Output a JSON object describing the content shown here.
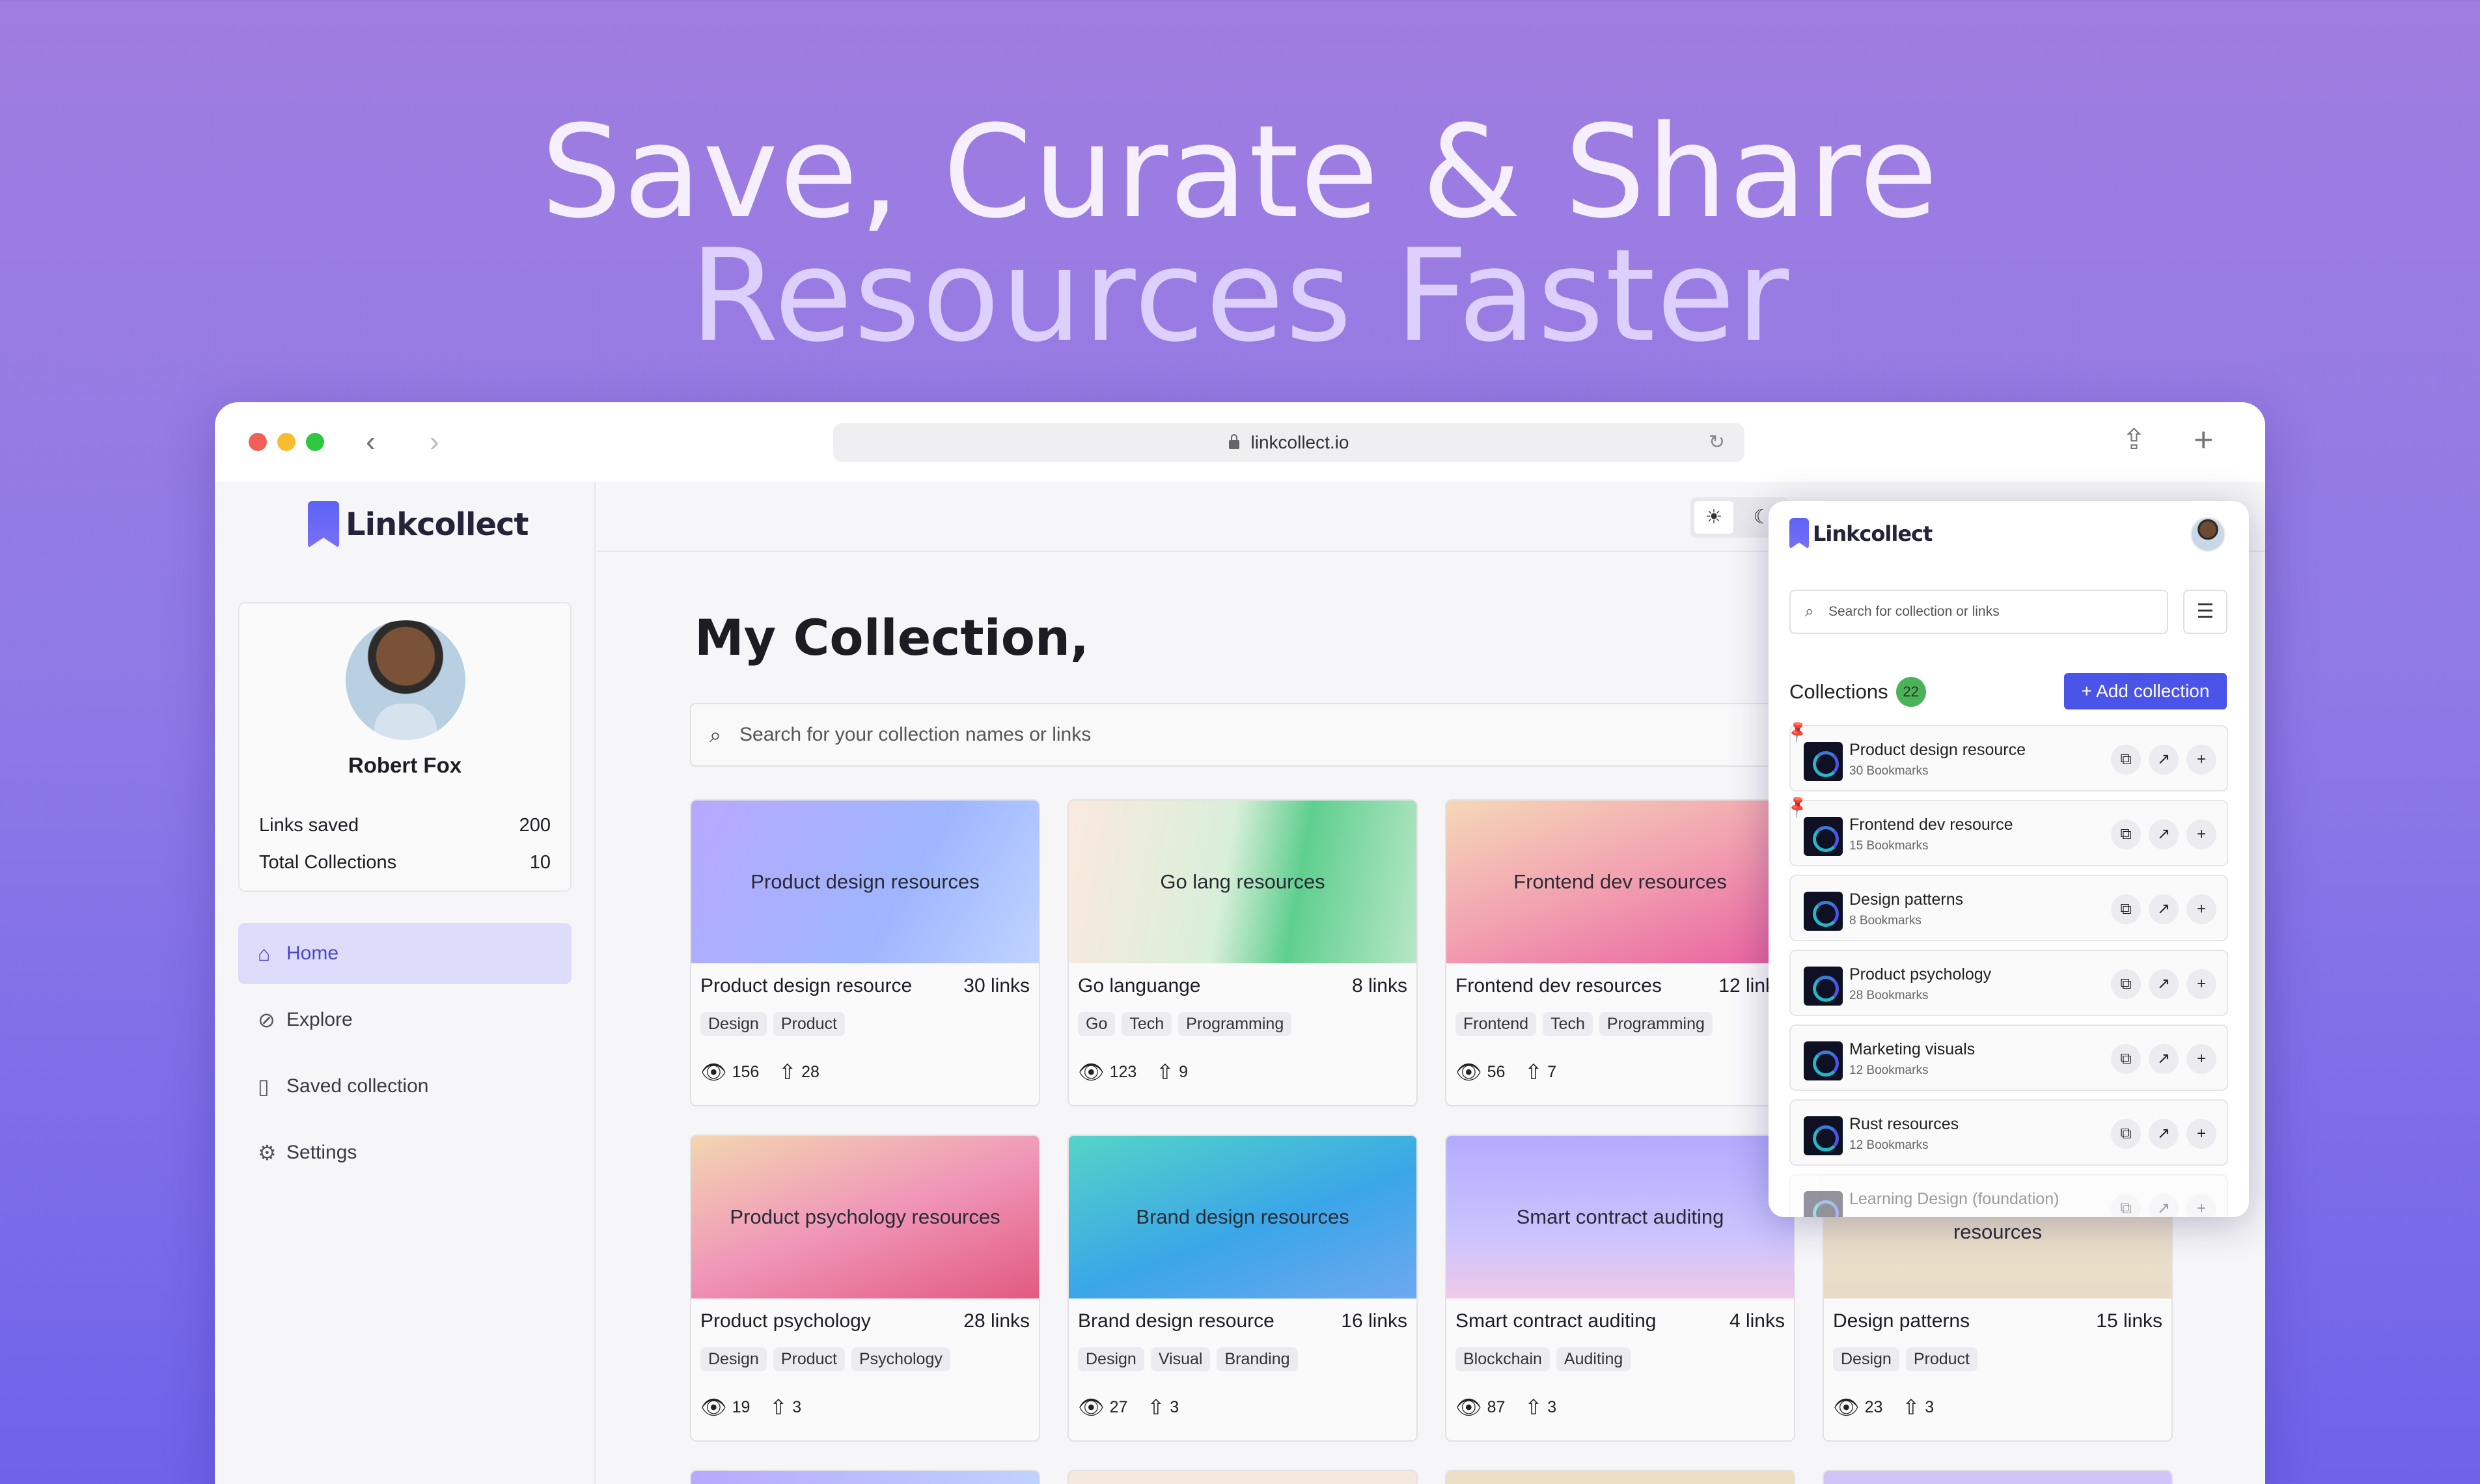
{
  "hero": {
    "line1": "Save, Curate & Share",
    "line2": "Resources Faster"
  },
  "browser": {
    "url": "linkcollect.io",
    "back_icon": "chevron-left-icon",
    "forward_icon": "chevron-right-icon",
    "share_icon": "share-icon",
    "newtab_icon": "plus-icon",
    "traffic_colors": [
      "#f25f57",
      "#f7bd2e",
      "#2bc840"
    ]
  },
  "sidebar": {
    "logo": "Linkcollect",
    "profile": {
      "name": "Robert Fox",
      "links_saved_label": "Links saved",
      "links_saved": "200",
      "total_collections_label": "Total Collections",
      "total_collections": "10"
    },
    "menu": [
      {
        "label": "Home",
        "icon": "home-icon"
      },
      {
        "label": "Explore",
        "icon": "compass-icon"
      },
      {
        "label": "Saved collection",
        "icon": "bookmark-icon"
      },
      {
        "label": "Settings",
        "icon": "gear-icon"
      }
    ]
  },
  "main": {
    "title": "My Collection,",
    "search_placeholder": "Search for your collection names or links",
    "cards": [
      {
        "thumb": "Product design resources",
        "name": "Product design resource",
        "links": "30 links",
        "tags": [
          "Design",
          "Product"
        ],
        "views": "156",
        "votes": "28"
      },
      {
        "thumb": "Go lang resources",
        "name": "Go languange",
        "links": "8 links",
        "tags": [
          "Go",
          "Tech",
          "Programming"
        ],
        "views": "123",
        "votes": "9"
      },
      {
        "thumb": "Frontend dev resources",
        "name": "Frontend dev resources",
        "links": "12 links",
        "tags": [
          "Frontend",
          "Tech",
          "Programming"
        ],
        "views": "56",
        "votes": "7"
      },
      {
        "thumb": "Product psychology resources",
        "name": "Product psychology",
        "links": "28 links",
        "tags": [
          "Design",
          "Product",
          "Psychology"
        ],
        "views": "19",
        "votes": "3"
      },
      {
        "thumb": "Brand design resources",
        "name": "Brand design resource",
        "links": "16 links",
        "tags": [
          "Design",
          "Visual",
          "Branding"
        ],
        "views": "27",
        "votes": "3"
      },
      {
        "thumb": "Smart contract auditing",
        "name": "Smart contract auditing",
        "links": "4 links",
        "tags": [
          "Blockchain",
          "Auditing"
        ],
        "views": "87",
        "votes": "3"
      },
      {
        "thumb": "resources",
        "name": "Design patterns",
        "links": "15 links",
        "tags": [
          "Design",
          "Product"
        ],
        "views": "23",
        "votes": "3"
      }
    ]
  },
  "popup": {
    "logo": "Linkcollect",
    "search_placeholder": "Search for collection or links",
    "collections_label": "Collections",
    "collections_count": "22",
    "add_label": "+ Add collection",
    "items": [
      {
        "title": "Product design resource",
        "sub": "30 Bookmarks",
        "pinned": true
      },
      {
        "title": "Frontend dev resource",
        "sub": "15 Bookmarks",
        "pinned": true
      },
      {
        "title": "Design patterns",
        "sub": "8 Bookmarks",
        "pinned": false
      },
      {
        "title": "Product psychology",
        "sub": "28 Bookmarks",
        "pinned": false
      },
      {
        "title": "Marketing visuals",
        "sub": "12 Bookmarks",
        "pinned": false
      },
      {
        "title": "Rust resources",
        "sub": "12 Bookmarks",
        "pinned": false
      },
      {
        "title": "Learning Design (foundation)",
        "sub": "",
        "pinned": false
      }
    ]
  }
}
